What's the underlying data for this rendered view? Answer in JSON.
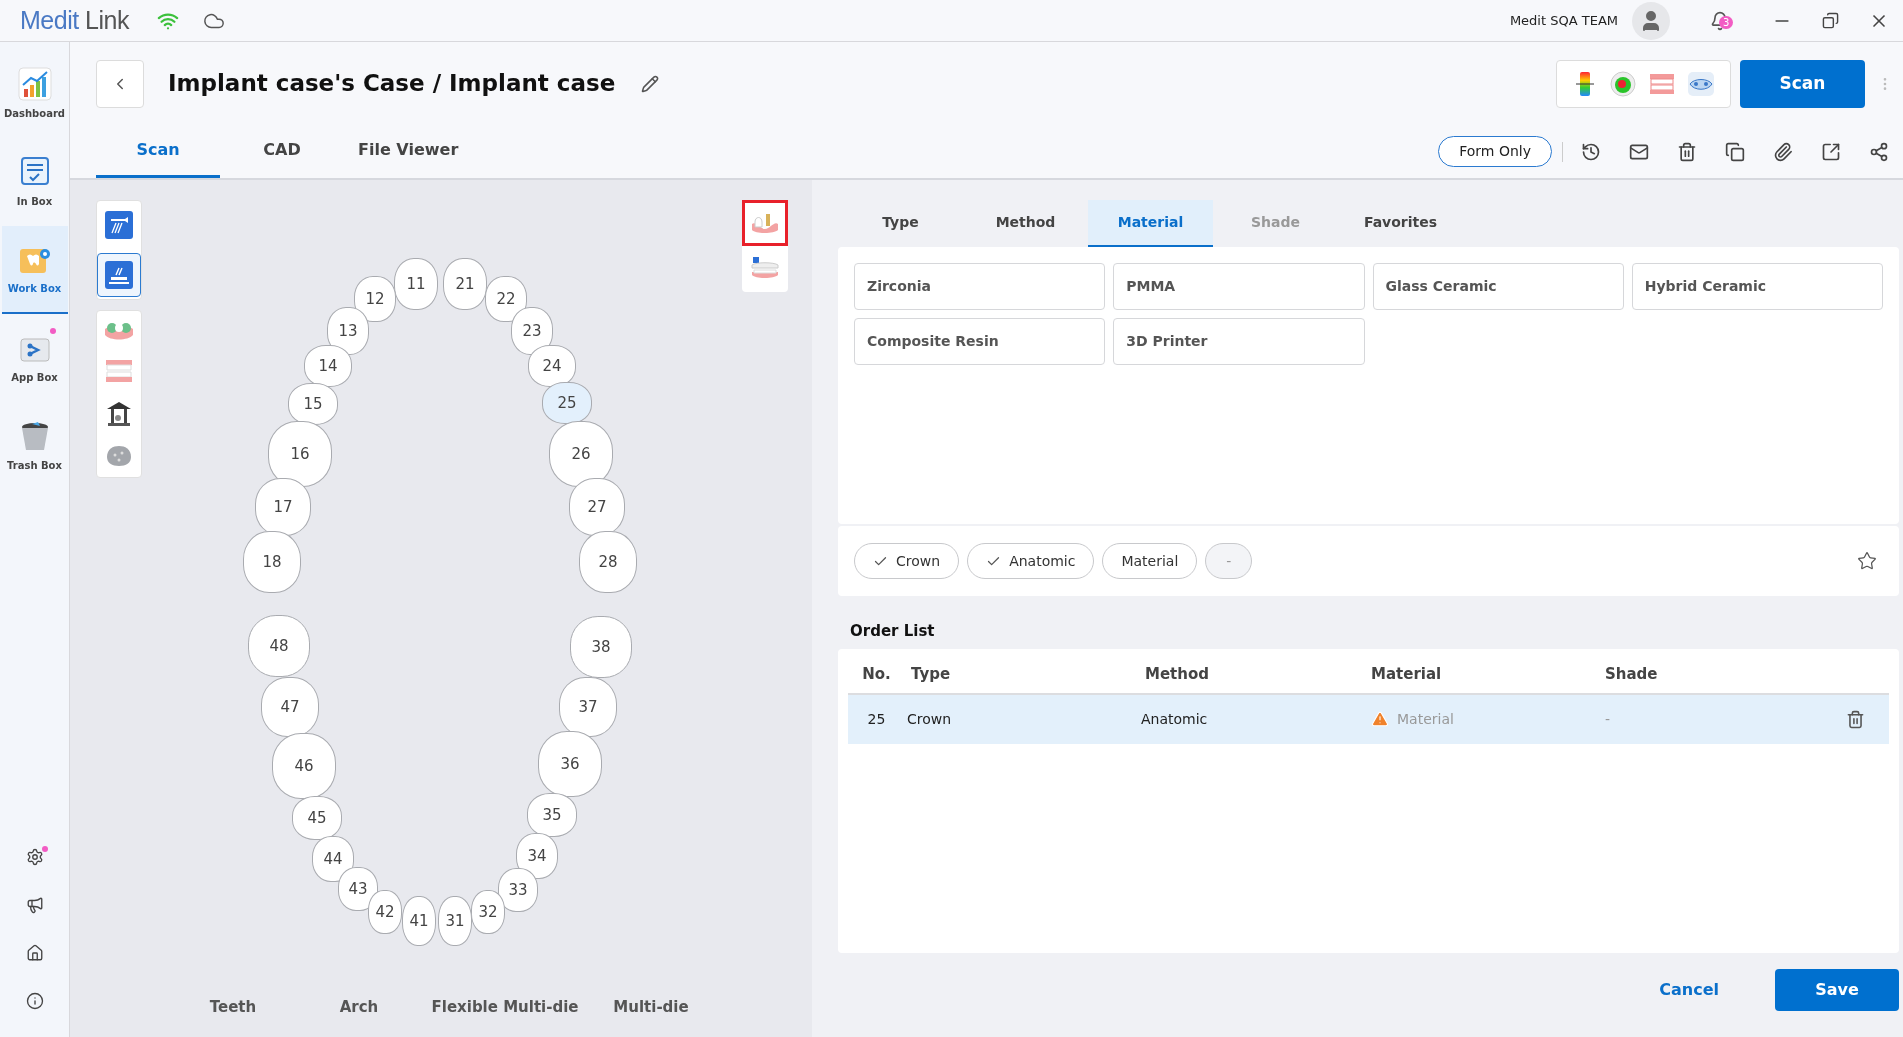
{
  "logo": {
    "first": "Medit",
    "second": "Link"
  },
  "user": {
    "name": "Medit SQA TEAM"
  },
  "notifications": {
    "count": "3"
  },
  "sidebar": {
    "items": [
      {
        "kind": "dashboard",
        "label": "Dashboard",
        "selected": false,
        "badge": false
      },
      {
        "kind": "inbox",
        "label": "In Box",
        "selected": false,
        "badge": false
      },
      {
        "kind": "workbox",
        "label": "Work Box",
        "selected": true,
        "badge": false
      },
      {
        "kind": "appbox",
        "label": "App Box",
        "selected": false,
        "badge": true
      },
      {
        "kind": "trash",
        "label": "Trash Box",
        "selected": false,
        "badge": false
      }
    ],
    "bottom_items": [
      {
        "kind": "settings",
        "badge": true
      },
      {
        "kind": "announcements",
        "badge": false
      },
      {
        "kind": "home",
        "badge": false
      },
      {
        "kind": "info",
        "badge": false
      }
    ]
  },
  "case": {
    "title": "Implant case's Case / Implant case"
  },
  "scan_button": "Scan",
  "view_tabs": [
    {
      "label": "Scan",
      "selected": true
    },
    {
      "label": "CAD",
      "selected": false
    },
    {
      "label": "File Viewer",
      "selected": false
    }
  ],
  "form_only_button": "Form Only",
  "scan_tools": [
    {
      "kind": "scanner",
      "selected": false
    },
    {
      "kind": "desktop",
      "selected": true
    }
  ],
  "implant_views": [
    {
      "kind": "implant",
      "selected": true
    },
    {
      "kind": "bite",
      "selected": false
    }
  ],
  "teeth": [
    {
      "number": "11",
      "selected": false
    },
    {
      "number": "21",
      "selected": false
    },
    {
      "number": "12",
      "selected": false
    },
    {
      "number": "22",
      "selected": false
    },
    {
      "number": "13",
      "selected": false
    },
    {
      "number": "23",
      "selected": false
    },
    {
      "number": "14",
      "selected": false
    },
    {
      "number": "24",
      "selected": false
    },
    {
      "number": "15",
      "selected": false
    },
    {
      "number": "25",
      "selected": true
    },
    {
      "number": "16",
      "selected": false
    },
    {
      "number": "26",
      "selected": false
    },
    {
      "number": "17",
      "selected": false
    },
    {
      "number": "27",
      "selected": false
    },
    {
      "number": "18",
      "selected": false
    },
    {
      "number": "28",
      "selected": false
    },
    {
      "number": "48",
      "selected": false
    },
    {
      "number": "38",
      "selected": false
    },
    {
      "number": "47",
      "selected": false
    },
    {
      "number": "37",
      "selected": false
    },
    {
      "number": "46",
      "selected": false
    },
    {
      "number": "36",
      "selected": false
    },
    {
      "number": "45",
      "selected": false
    },
    {
      "number": "35",
      "selected": false
    },
    {
      "number": "44",
      "selected": false
    },
    {
      "number": "34",
      "selected": false
    },
    {
      "number": "43",
      "selected": false
    },
    {
      "number": "33",
      "selected": false
    },
    {
      "number": "42",
      "selected": false
    },
    {
      "number": "32",
      "selected": false
    },
    {
      "number": "41",
      "selected": false
    },
    {
      "number": "31",
      "selected": false
    }
  ],
  "mode_tabs": [
    "Teeth",
    "Arch",
    "Flexible Multi-die",
    "Multi-die"
  ],
  "option_tabs": [
    {
      "label": "Type",
      "selected": false,
      "disabled": false
    },
    {
      "label": "Method",
      "selected": false,
      "disabled": false
    },
    {
      "label": "Material",
      "selected": true,
      "disabled": false
    },
    {
      "label": "Shade",
      "selected": false,
      "disabled": true
    },
    {
      "label": "Favorites",
      "selected": false,
      "disabled": false
    }
  ],
  "materials": [
    "Zirconia",
    "PMMA",
    "Glass Ceramic",
    "Hybrid Ceramic",
    "Composite Resin",
    "3D Printer"
  ],
  "summary_chips": [
    {
      "label": "Crown",
      "checked": true,
      "kind": "value"
    },
    {
      "label": "Anatomic",
      "checked": true,
      "kind": "value"
    },
    {
      "label": "Material",
      "checked": false,
      "kind": "value"
    },
    {
      "label": "-",
      "checked": false,
      "kind": "empty"
    }
  ],
  "order_list": {
    "title": "Order List",
    "columns": [
      "No.",
      "Type",
      "Method",
      "Material",
      "Shade"
    ],
    "rows": [
      {
        "no": "25",
        "type": "Crown",
        "method": "Anatomic",
        "material": "Material",
        "material_missing": true,
        "shade": "-",
        "selected": true
      }
    ]
  },
  "actions": {
    "cancel": "Cancel",
    "save": "Save"
  }
}
